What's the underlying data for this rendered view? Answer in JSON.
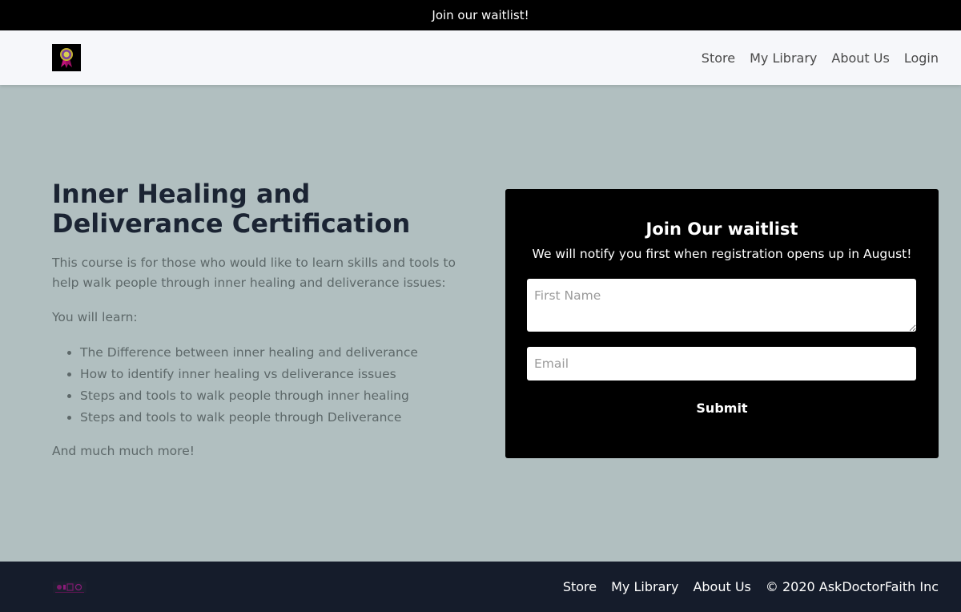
{
  "announcement": {
    "text": "Join our waitlist!"
  },
  "header": {
    "logo_icon": "ribbon-badge-logo",
    "nav": [
      "Store",
      "My Library",
      "About Us",
      "Login"
    ]
  },
  "course": {
    "title": "Inner Healing and Deliverance Certification",
    "intro": "This course is for those who would like to learn skills and tools to help walk people through inner healing and deliverance issues:",
    "learn_heading": "You will learn:",
    "bullets": [
      "The Difference between inner healing and deliverance",
      "How to identify inner healing vs deliverance issues",
      "Steps and tools to walk people through inner healing",
      "Steps and tools to walk people through Deliverance"
    ],
    "closing": "And much much more!"
  },
  "waitlist": {
    "title": "Join Our waitlist",
    "subtitle": "We will notify you first when registration opens up in August!",
    "first_name_placeholder": "First Name",
    "email_placeholder": "Email",
    "submit_label": "Submit"
  },
  "footer": {
    "nav": [
      "Store",
      "My Library",
      "About Us"
    ],
    "copyright": "© 2020 AskDoctorFaith Inc"
  },
  "colors": {
    "announcement_bg": "#000000",
    "header_bg": "#f6f7fa",
    "page_bg": "#b1bfc0",
    "card_bg": "#000000",
    "footer_bg": "#151c2b",
    "heading": "#1b2433"
  }
}
